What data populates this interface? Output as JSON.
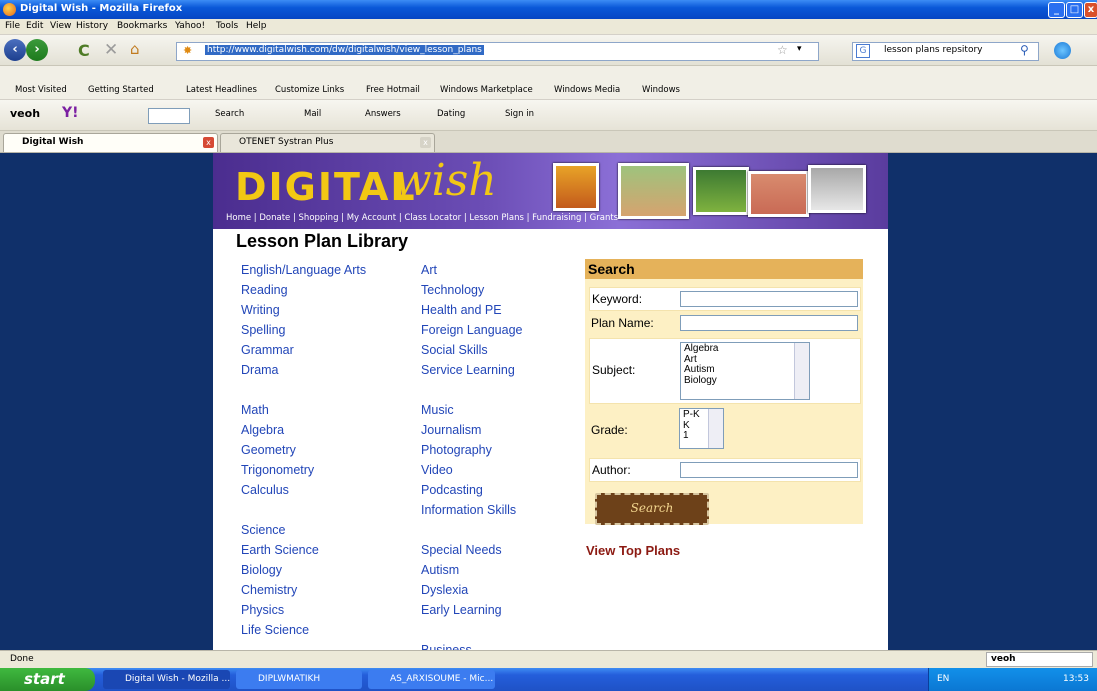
{
  "window": {
    "title": "Digital Wish - Mozilla Firefox"
  },
  "menu": [
    "File",
    "Edit",
    "View",
    "History",
    "Bookmarks",
    "Yahoo!",
    "Tools",
    "Help"
  ],
  "nav": {
    "url": "http://www.digitalwish.com/dw/digitalwish/view_lesson_plans",
    "search_value": "lesson plans repsitory"
  },
  "bookmarks": [
    "Most Visited",
    "Getting Started",
    "Latest Headlines",
    "Customize Links",
    "Free Hotmail",
    "Windows Marketplace",
    "Windows Media",
    "Windows"
  ],
  "toolbar": {
    "items": [
      "Search",
      "Mail",
      "Answers",
      "Dating",
      "Sign in"
    ]
  },
  "tabs": [
    {
      "label": "Digital Wish"
    },
    {
      "label": "OTENET Systran Plus"
    }
  ],
  "site": {
    "banner_nav": "Home | Donate | Shopping | My Account | Class Locator | Lesson Plans | Fundraising | Grants",
    "heading": "Lesson Plan Library",
    "col1": [
      "English/Language Arts",
      "Reading",
      "Writing",
      "Spelling",
      "Grammar",
      "Drama",
      "",
      "Math",
      "Algebra",
      "Geometry",
      "Trigonometry",
      "Calculus",
      "",
      "Science",
      "Earth Science",
      "Biology",
      "Chemistry",
      "Physics",
      "Life Science"
    ],
    "col2": [
      "Art",
      "Technology",
      "Health and PE",
      "Foreign Language",
      "Social Skills",
      "Service Learning",
      "",
      "Music",
      "Journalism",
      "Photography",
      "Video",
      "Podcasting",
      "Information Skills",
      "",
      "Special Needs",
      "Autism",
      "Dyslexia",
      "Early Learning",
      "",
      "Business"
    ],
    "search": {
      "title": "Search",
      "keyword_label": "Keyword:",
      "plan_label": "Plan Name:",
      "subject_label": "Subject:",
      "subject_options": [
        "Algebra",
        "Art",
        "Autism",
        "Biology"
      ],
      "grade_label": "Grade:",
      "grade_options": [
        "P-K",
        "K",
        "1"
      ],
      "author_label": "Author:",
      "button": "Search"
    },
    "top_plans": "View Top Plans"
  },
  "status": {
    "text": "Done"
  },
  "taskbar": {
    "start": "start",
    "tasks": [
      "Digital Wish - Mozilla ...",
      "DIPLWMATIKH",
      "AS_ARXISOUME - Mic..."
    ],
    "lang": "EN",
    "time": "13:53"
  }
}
